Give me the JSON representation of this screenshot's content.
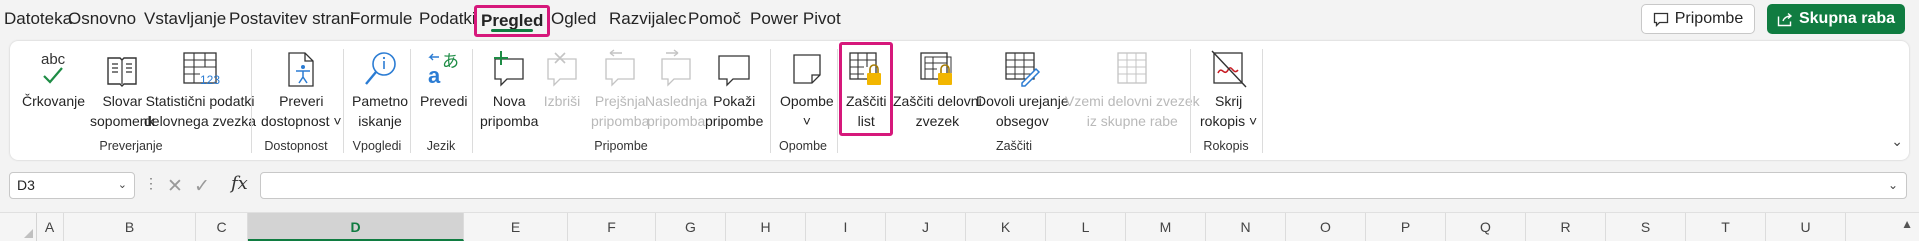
{
  "tabs": [
    "Datoteka",
    "Osnovno",
    "Vstavljanje",
    "Postavitev strani",
    "Formule",
    "Podatki",
    "Pregled",
    "Ogled",
    "Razvijalec",
    "Pomoč",
    "Power Pivot"
  ],
  "active_tab": "Pregled",
  "header_buttons": {
    "comments": "Pripombe",
    "share": "Skupna raba"
  },
  "ribbon": {
    "spelling": "Črkovanje",
    "thesaurus": [
      "Slovar",
      "sopomenk"
    ],
    "workbook_stats": [
      "Statistični podatki",
      "delovnega zvezka"
    ],
    "check_accessibility": [
      "Preveri",
      "dostopnost ˅"
    ],
    "smart_lookup": [
      "Pametno",
      "iskanje"
    ],
    "translate": "Prevedi",
    "new_comment": [
      "Nova",
      "pripomba"
    ],
    "delete_comment": "Izbriši",
    "previous_comment": [
      "Prejšnja",
      "pripomba"
    ],
    "next_comment": [
      "Naslednja",
      "pripomba"
    ],
    "show_comments": [
      "Pokaži",
      "pripombe"
    ],
    "notes": [
      "Opombe",
      "˅"
    ],
    "protect_sheet": [
      "Zaščiti",
      "list"
    ],
    "protect_workbook": [
      "Zaščiti delovni",
      "zvezek"
    ],
    "allow_edit_ranges": [
      "Dovoli urejanje",
      "obsegov"
    ],
    "unshare_workbook": [
      "Vzemi delovni zvezek",
      "iz skupne rabe"
    ],
    "hide_ink": [
      "Skrij",
      "rokopis ˅"
    ],
    "groups": {
      "proofing": "Preverjanje",
      "accessibility": "Dostopnost",
      "insights": "Vpogledi",
      "language": "Jezik",
      "comments": "Pripombe",
      "notes": "Opombe",
      "protect": "Zaščiti",
      "ink": "Rokopis"
    }
  },
  "formula_bar": {
    "name_box": "D3",
    "fx": "fx",
    "formula": ""
  },
  "columns": [
    "A",
    "B",
    "C",
    "D",
    "E",
    "F",
    "G",
    "H",
    "I",
    "J",
    "K",
    "L",
    "M",
    "N",
    "O",
    "P",
    "Q",
    "R",
    "S",
    "T",
    "U"
  ],
  "selected_column": "D",
  "colors": {
    "accent_green": "#107c41",
    "highlight_pink": "#d6187b",
    "icon_blue": "#2b7cd3"
  }
}
